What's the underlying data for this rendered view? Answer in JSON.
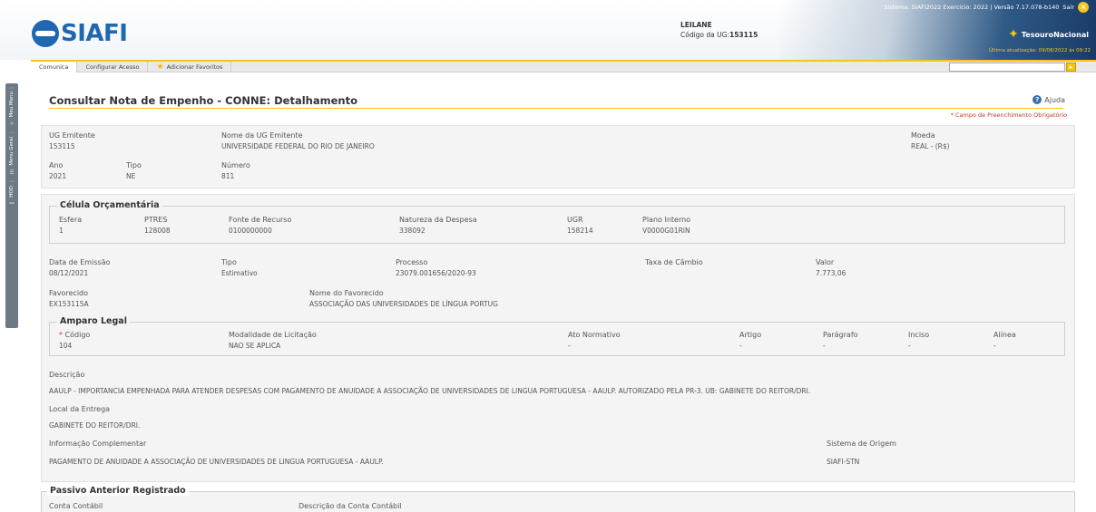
{
  "header": {
    "logo_text": "SIAFI",
    "user_name": "LEILANE",
    "ug_code_label": "Código da UG:",
    "ug_code_value": "153115",
    "system_info": "Sistema: SIAFI2022 Exercício: 2022 | Versão 7.17.078-b140",
    "sair_label": "Sair",
    "tesouro": "TesouroNacional",
    "last_update": "Última atualização: 09/08/2022 às 09:22"
  },
  "menu": {
    "items": [
      "Comunica",
      "Configurar Acesso",
      "Adicionar Favoritos"
    ]
  },
  "side_tabs": [
    "Meu Menu",
    "Menu Geral",
    "HOD"
  ],
  "page": {
    "title": "Consultar Nota de Empenho - CONNE: Detalhamento",
    "help_label": "Ajuda",
    "required_note": "* Campo de Preenchimento Obrigatório"
  },
  "top_panel": {
    "ug_emitente_label": "UG Emitente",
    "ug_emitente_value": "153115",
    "nome_ug_label": "Nome da UG Emitente",
    "nome_ug_value": "UNIVERSIDADE FEDERAL DO RIO DE JANEIRO",
    "moeda_label": "Moeda",
    "moeda_value": "REAL - (R$)",
    "ano_label": "Ano",
    "ano_value": "2021",
    "tipo_label": "Tipo",
    "tipo_value": "NE",
    "numero_label": "Número",
    "numero_value": "811"
  },
  "celula": {
    "legend": "Célula Orçamentária",
    "esfera_label": "Esfera",
    "esfera_value": "1",
    "ptres_label": "PTRES",
    "ptres_value": "128008",
    "fonte_label": "Fonte de Recurso",
    "fonte_value": "0100000000",
    "natureza_label": "Natureza da Despesa",
    "natureza_value": "338092",
    "ugr_label": "UGR",
    "ugr_value": "158214",
    "plano_label": "Plano Interno",
    "plano_value": "V0000G01RIN"
  },
  "details": {
    "data_emissao_label": "Data de Emissão",
    "data_emissao_value": "08/12/2021",
    "tipo_label": "Tipo",
    "tipo_value": "Estimativo",
    "processo_label": "Processo",
    "processo_value": "23079.001656/2020-93",
    "taxa_label": "Taxa de Câmbio",
    "valor_label": "Valor",
    "valor_value": "7.773,06",
    "favorecido_label": "Favorecido",
    "favorecido_value": "EX153115A",
    "nome_favorecido_label": "Nome do Favorecido",
    "nome_favorecido_value": "ASSOCIAÇÃO DAS UNIVERSIDADES DE LÍNGUA PORTUG"
  },
  "amparo": {
    "legend": "Amparo Legal",
    "req_mark": "*",
    "codigo_label": "Código",
    "codigo_value": "104",
    "modalidade_label": "Modalidade de Licitação",
    "modalidade_value": "NAO SE APLICA",
    "ato_label": "Ato Normativo",
    "ato_value": "-",
    "artigo_label": "Artigo",
    "artigo_value": "-",
    "paragrafo_label": "Parágrafo",
    "paragrafo_value": "-",
    "inciso_label": "Inciso",
    "inciso_value": "-",
    "alinea_label": "Alínea",
    "alinea_value": "-"
  },
  "descricao": {
    "label": "Descrição",
    "value": "AAULP - IMPORTANCIA EMPENHADA PARA ATENDER DESPESAS COM PAGAMENTO DE ANUIDADE A ASSOCIAÇÃO DE UNIVERSIDADES DE LINGUA PORTUGUESA - AAULP. AUTORIZADO PELA PR-3. UB: GABINETE DO REITOR/DRI.",
    "local_label": "Local da Entrega",
    "local_value": "GABINETE DO REITOR/DRI.",
    "info_label": "Informação Complementar",
    "info_value": "PAGAMENTO DE ANUIDADE A ASSOCIAÇÃO DE UNIVERSIDADES DE LINGUA PORTUGUESA - AAULP.",
    "sistema_label": "Sistema de Origem",
    "sistema_value": "SIAFI-STN"
  },
  "passivo": {
    "legend": "Passivo Anterior Registrado",
    "conta_label": "Conta Contábil",
    "descricao_conta_label": "Descrição da Conta Contábil"
  }
}
